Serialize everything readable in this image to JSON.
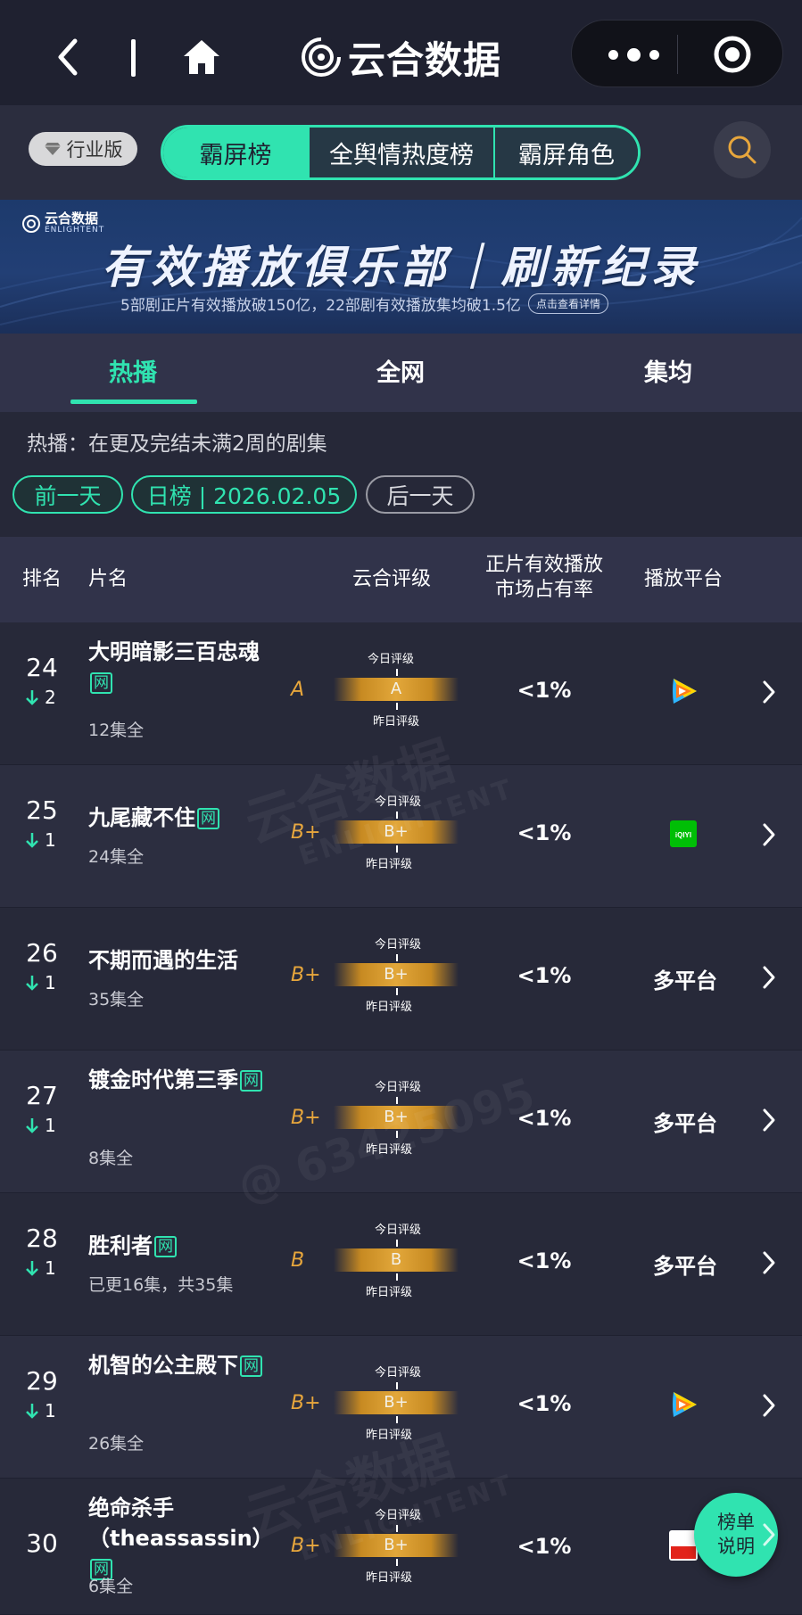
{
  "nav": {
    "brand": "云合数据"
  },
  "subnav": {
    "edition_badge": "行业版",
    "tabs": [
      "霸屏榜",
      "全舆情热度榜",
      "霸屏角色"
    ]
  },
  "banner": {
    "logo_text": "云合数据",
    "logo_sub": "ENLIGHTENT",
    "title": "有效播放俱乐部｜刷新纪录",
    "subtitle": "5部剧正片有效播放破150亿，22部剧有效播放集均破1.5亿",
    "link": "点击查看详情"
  },
  "tabs": [
    "热播",
    "全网",
    "集均"
  ],
  "description": "热播：在更及完结未满2周的剧集",
  "date_nav": {
    "prev": "前一天",
    "current": "日榜 | 2026.02.05",
    "next": "后一天"
  },
  "table": {
    "headers": {
      "rank": "排名",
      "title": "片名",
      "grade": "云合评级",
      "share_l1": "正片有效播放",
      "share_l2": "市场占有率",
      "platform": "播放平台"
    },
    "grade_today_label": "今日评级",
    "grade_yesterday_label": "昨日评级",
    "rows": [
      {
        "rank": "24",
        "change": "2",
        "title": "大明暗影三百忠魂",
        "net_tag": "网",
        "episodes": "12集全",
        "grade": "A",
        "grade_bar": "A",
        "share": "<1%",
        "platform": "",
        "platform_icon": "tencent-video-icon"
      },
      {
        "rank": "25",
        "change": "1",
        "title": "九尾藏不住",
        "net_tag": "网",
        "episodes": "24集全",
        "grade": "B+",
        "grade_bar": "B+",
        "share": "<1%",
        "platform": "",
        "platform_icon": "iqiyi-icon"
      },
      {
        "rank": "26",
        "change": "1",
        "title": "不期而遇的生活",
        "net_tag": "",
        "episodes": "35集全",
        "grade": "B+",
        "grade_bar": "B+",
        "share": "<1%",
        "platform": "多平台",
        "platform_icon": ""
      },
      {
        "rank": "27",
        "change": "1",
        "title": "镀金时代第三季",
        "net_tag": "网",
        "episodes": "8集全",
        "grade": "B+",
        "grade_bar": "B+",
        "share": "<1%",
        "platform": "多平台",
        "platform_icon": ""
      },
      {
        "rank": "28",
        "change": "1",
        "title": "胜利者",
        "net_tag": "网",
        "episodes": "已更16集，共35集",
        "grade": "B",
        "grade_bar": "B",
        "share": "<1%",
        "platform": "多平台",
        "platform_icon": ""
      },
      {
        "rank": "29",
        "change": "1",
        "title": "机智的公主殿下",
        "net_tag": "网",
        "episodes": "26集全",
        "grade": "B+",
        "grade_bar": "B+",
        "share": "<1%",
        "platform": "",
        "platform_icon": "tencent-video-icon"
      },
      {
        "rank": "30",
        "change": "",
        "title": "绝命杀手（theassassin）",
        "net_tag": "网",
        "episodes": "6集全",
        "grade": "B+",
        "grade_bar": "B+",
        "share": "<1%",
        "platform": "",
        "platform_icon": "sohu-video-icon"
      }
    ]
  },
  "fab": {
    "line1": "榜单",
    "line2": "说明"
  },
  "watermark": {
    "brand": "云合数据",
    "brand_sub": "ENLIGHTENT",
    "user": "@ 63425095"
  },
  "colors": {
    "accent": "#30e3b0",
    "grade": "#e7a63c",
    "background": "#262838"
  }
}
